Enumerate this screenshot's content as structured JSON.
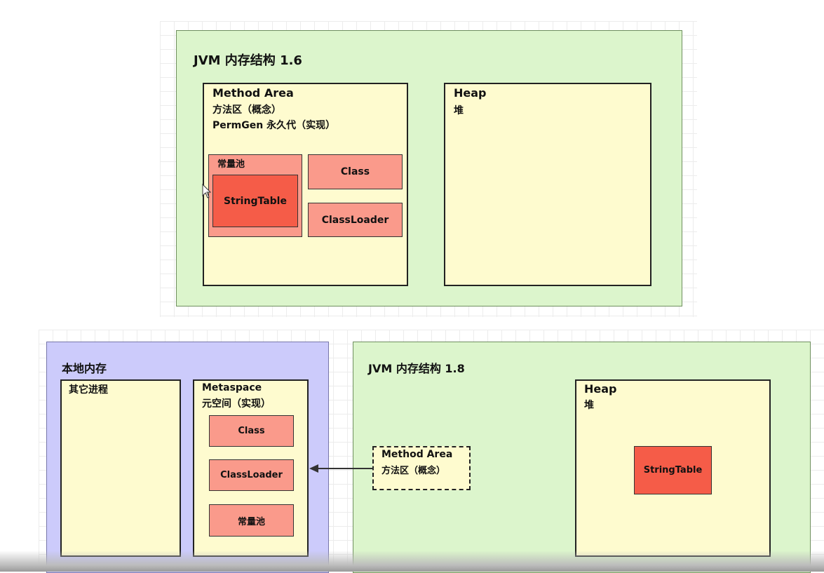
{
  "jvm16": {
    "title": "JVM 内存结构 1.6",
    "method_area": {
      "name": "Method Area",
      "line2": "方法区（概念）",
      "line3": "PermGen 永久代（实现）"
    },
    "const_pool": "常量池",
    "string_table": "StringTable",
    "class": "Class",
    "classloader": "ClassLoader",
    "heap": {
      "name": "Heap",
      "sub": "堆"
    }
  },
  "native": {
    "title": "本地内存",
    "other_process": "其它进程",
    "metaspace": {
      "name": "Metaspace",
      "sub": "元空间（实现）"
    },
    "class": "Class",
    "classloader": "ClassLoader",
    "const_pool": "常量池"
  },
  "jvm18": {
    "title": "JVM 内存结构 1.8",
    "method_area": {
      "name": "Method Area",
      "sub": "方法区（概念）"
    },
    "heap": {
      "name": "Heap",
      "sub": "堆"
    },
    "string_table": "StringTable"
  },
  "colors": {
    "jvm_bg": "#dcf5cc",
    "native_bg": "#cccbfb",
    "area_bg": "#fefbcf",
    "item_bg": "#fa9a8b",
    "string_table_bg": "#f55c48"
  }
}
